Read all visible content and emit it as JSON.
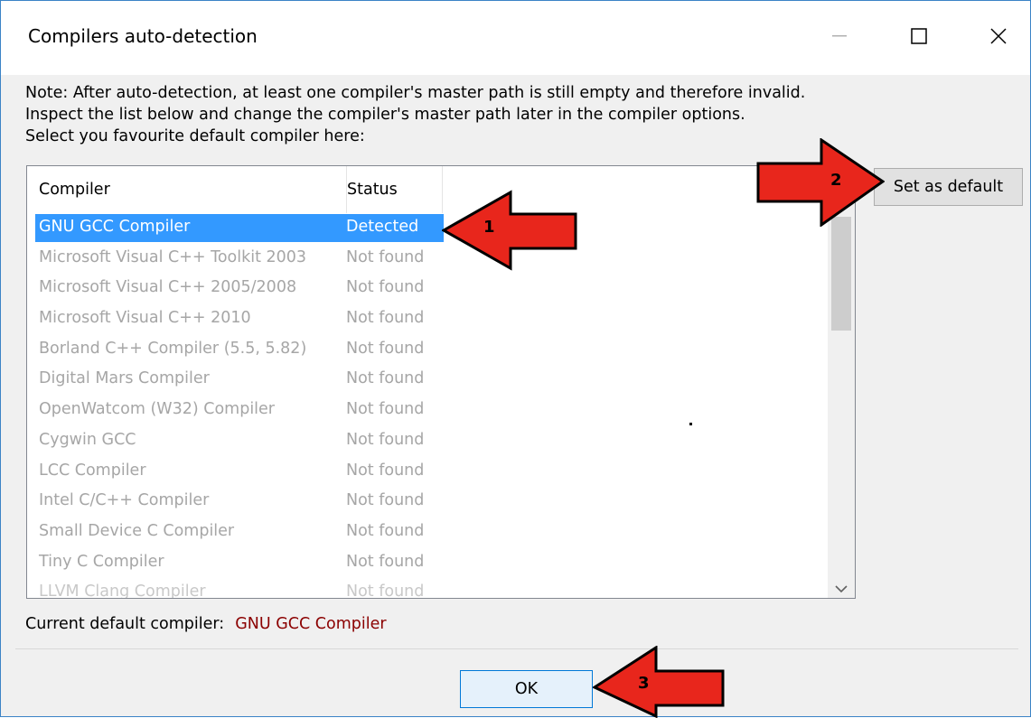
{
  "window": {
    "title": "Compilers auto-detection",
    "minimize_icon": "minimize-icon",
    "maximize_icon": "maximize-icon",
    "close_icon": "close-icon"
  },
  "note": {
    "line1": "Note: After auto-detection, at least one compiler's master path is still empty and therefore invalid.",
    "line2": "Inspect the list below and change the compiler's master path later in the compiler options.",
    "line3": "Select you favourite default compiler here:"
  },
  "list": {
    "columns": [
      "Compiler",
      "Status"
    ],
    "rows": [
      {
        "compiler": "GNU GCC Compiler",
        "status": "Detected"
      },
      {
        "compiler": "Microsoft Visual C++ Toolkit 2003",
        "status": "Not found"
      },
      {
        "compiler": "Microsoft Visual C++ 2005/2008",
        "status": "Not found"
      },
      {
        "compiler": "Microsoft Visual C++ 2010",
        "status": "Not found"
      },
      {
        "compiler": "Borland C++ Compiler (5.5, 5.82)",
        "status": "Not found"
      },
      {
        "compiler": "Digital Mars Compiler",
        "status": "Not found"
      },
      {
        "compiler": "OpenWatcom (W32) Compiler",
        "status": "Not found"
      },
      {
        "compiler": "Cygwin GCC",
        "status": "Not found"
      },
      {
        "compiler": "LCC Compiler",
        "status": "Not found"
      },
      {
        "compiler": "Intel C/C++ Compiler",
        "status": "Not found"
      },
      {
        "compiler": "Small Device C Compiler",
        "status": "Not found"
      },
      {
        "compiler": "Tiny C Compiler",
        "status": "Not found"
      },
      {
        "compiler": "LLVM Clang Compiler",
        "status": "Not found"
      }
    ],
    "scroll_down_icon": "chevron-down-icon"
  },
  "buttons": {
    "set_default": "Set as default",
    "ok": "OK"
  },
  "current": {
    "label": "Current default compiler:",
    "value": "GNU GCC Compiler"
  },
  "annotations": {
    "arrow1": "1",
    "arrow2": "2",
    "arrow3": "3",
    "arrow_color": "#e8261c"
  }
}
